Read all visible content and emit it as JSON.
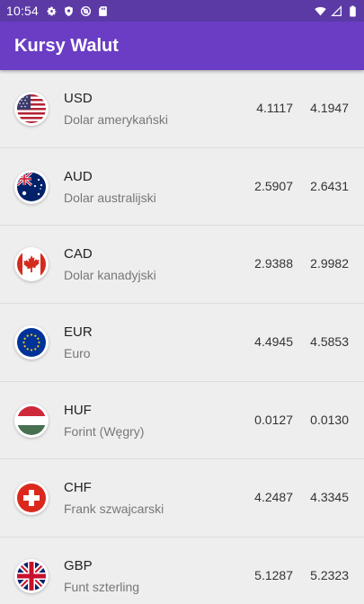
{
  "status_bar": {
    "time": "10:54",
    "icons_left": [
      "gear-icon",
      "shield-icon",
      "at-sign-icon",
      "sd-card-icon"
    ],
    "icons_right": [
      "wifi-icon",
      "signal-icon",
      "battery-icon"
    ]
  },
  "app_bar": {
    "title": "Kursy Walut"
  },
  "currencies": [
    {
      "code": "USD",
      "name": "Dolar amerykański",
      "buy": "4.1117",
      "sell": "4.1947",
      "flag": "us-flag-icon"
    },
    {
      "code": "AUD",
      "name": "Dolar australijski",
      "buy": "2.5907",
      "sell": "2.6431",
      "flag": "au-flag-icon"
    },
    {
      "code": "CAD",
      "name": "Dolar kanadyjski",
      "buy": "2.9388",
      "sell": "2.9982",
      "flag": "ca-flag-icon"
    },
    {
      "code": "EUR",
      "name": "Euro",
      "buy": "4.4945",
      "sell": "4.5853",
      "flag": "eu-flag-icon"
    },
    {
      "code": "HUF",
      "name": "Forint (Węgry)",
      "buy": "0.0127",
      "sell": "0.0130",
      "flag": "hu-flag-icon"
    },
    {
      "code": "CHF",
      "name": "Frank szwajcarski",
      "buy": "4.2487",
      "sell": "4.3345",
      "flag": "ch-flag-icon"
    },
    {
      "code": "GBP",
      "name": "Funt szterling",
      "buy": "5.1287",
      "sell": "5.2323",
      "flag": "gb-flag-icon"
    }
  ],
  "colors": {
    "status_bar": "#5b3aa6",
    "app_bar": "#6a3dc4",
    "background": "#eeeeee"
  }
}
